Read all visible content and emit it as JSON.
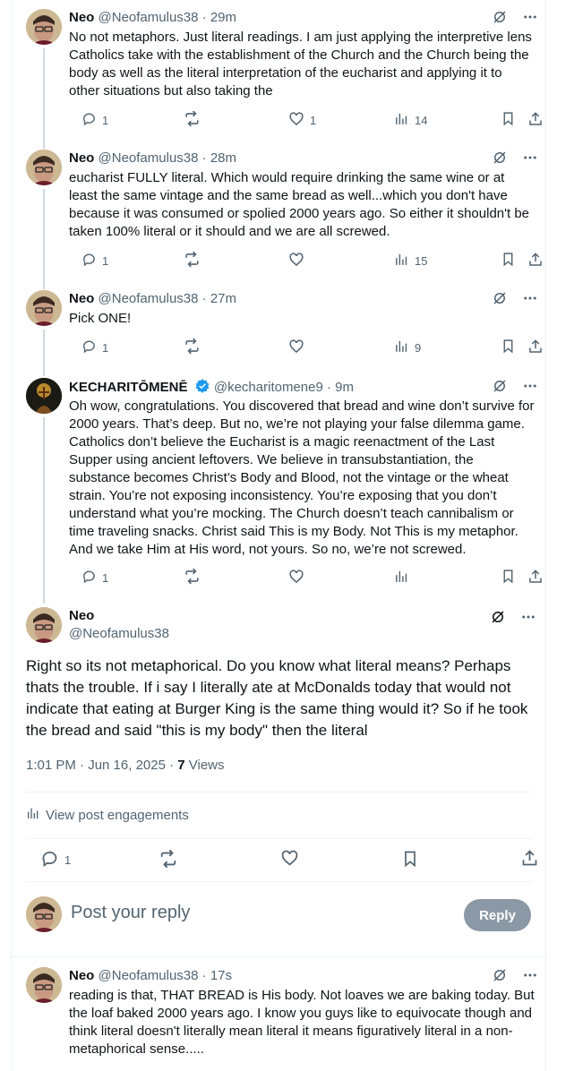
{
  "posts": [
    {
      "name": "Neo",
      "handle": "@Neofamulus38",
      "time": "29m",
      "text": "No not metaphors. Just literal readings. I am just applying the interpretive lens Catholics take with the establishment of the Church and the Church being the body as well as the literal interpretation of the eucharist and applying it to other situations but also taking the",
      "replies": "1",
      "reposts": "",
      "likes": "1",
      "views": "14"
    },
    {
      "name": "Neo",
      "handle": "@Neofamulus38",
      "time": "28m",
      "text": "eucharist FULLY literal. Which would require drinking the same wine or at least the same vintage and the same bread as well...which you don't have because it was consumed or spolied 2000 years ago. So either it shouldn't be taken 100% literal or it should and we are all screwed.",
      "replies": "1",
      "reposts": "",
      "likes": "",
      "views": "15"
    },
    {
      "name": "Neo",
      "handle": "@Neofamulus38",
      "time": "27m",
      "text": "Pick ONE!",
      "replies": "1",
      "reposts": "",
      "likes": "",
      "views": "9"
    },
    {
      "name": "KECHARITŌMENĒ",
      "handle": "@kecharitomene9",
      "time": "9m",
      "text": "Oh wow, congratulations. You discovered that bread and wine don’t survive for 2000 years. That’s deep. But no, we’re not playing your false dilemma game. Catholics don’t believe the Eucharist is a magic reenactment of the Last Supper using ancient leftovers. We believe in transubstantiation, the substance becomes Christ’s Body and Blood, not the vintage or the wheat strain. You’re not exposing inconsistency. You’re exposing that you don’t understand what you’re mocking. The Church doesn’t teach cannibalism or time traveling snacks. Christ said This is my Body. Not This is my metaphor. And we take Him at His word, not yours. So no, we’re not screwed.",
      "replies": "1",
      "reposts": "",
      "likes": "",
      "views": ""
    }
  ],
  "main": {
    "name": "Neo",
    "handle": "@Neofamulus38",
    "text": "Right so its not metaphorical. Do you know what literal means? Perhaps thats the trouble. If i say I literally ate at McDonalds today that would not indicate that eating at Burger King is the same thing would it? So if he took the bread and said \"this is my body\" then the literal",
    "timestamp": "1:01 PM · Jun 16, 2025 · ",
    "views_count": "7",
    "views_label": " Views",
    "engagements": "View post engagements",
    "replies": "1"
  },
  "reply_box": {
    "placeholder": "Post your reply",
    "button": "Reply"
  },
  "last_post": {
    "name": "Neo",
    "handle": "@Neofamulus38",
    "time": "17s",
    "text": "reading is that, THAT BREAD is His body. Not loaves we are baking today. But the loaf baked 2000 years ago. I know you guys like to equivocate though and think literal doesn't literally mean literal it means figuratively literal in a non-metaphorical sense....."
  },
  "colors": {
    "text": "#0f1419",
    "muted": "#536471",
    "thread_line": "#cfd9de",
    "verified": "#1d9bf0",
    "reply_button_disabled": "#8b98a5"
  }
}
